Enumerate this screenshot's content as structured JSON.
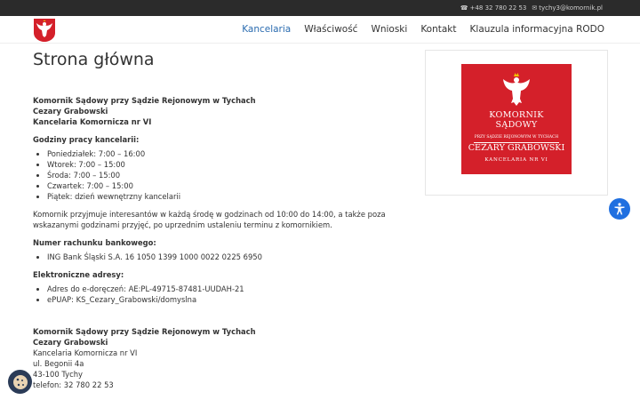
{
  "topbar": {
    "phone": "+48 32 780 22 53",
    "email": "tychy3@komornik.pl"
  },
  "nav": {
    "items": [
      {
        "label": "Kancelaria",
        "active": true
      },
      {
        "label": "Właściwość",
        "active": false
      },
      {
        "label": "Wnioski",
        "active": false
      },
      {
        "label": "Kontakt",
        "active": false
      },
      {
        "label": "Klauzula informacyjna RODO",
        "active": false
      }
    ]
  },
  "page": {
    "title": "Strona główna"
  },
  "content": {
    "header_line1": "Komornik Sądowy przy Sądzie Rejonowym w Tychach",
    "header_line2": "Cezary Grabowski",
    "header_line3": "Kancelaria Komornicza nr VI",
    "hours_title": "Godziny pracy kancelarii:",
    "hours": [
      "Poniedziałek: 7:00 – 16:00",
      "Wtorek: 7:00 – 15:00",
      "Środa: 7:00 – 15:00",
      "Czwartek: 7:00 – 15:00",
      "Piątek: dzień wewnętrzny kancelarii"
    ],
    "reception_text": "Komornik przyjmuje interesantów w każdą środę w godzinach od 10:00 do 14:00, a także poza wskazanymi godzinami przyjęć, po uprzednim ustaleniu terminu z komornikiem.",
    "bank_title": "Numer rachunku bankowego:",
    "bank_account": "ING Bank Śląski S.A. 16 1050 1399 1000 0022 0225 6950",
    "electronic_title": "Elektroniczne adresy:",
    "electronic": [
      "Adres do e-doręczeń: AE:PL-49715-87481-UUDAH-21",
      "ePUAP: KS_Cezary_Grabowski/domyslna"
    ],
    "footer_line1": "Komornik Sądowy przy Sądzie Rejonowym w Tychach",
    "footer_line2": "Cezary Grabowski",
    "footer_line3": "Kancelaria Komornicza nr VI",
    "footer_line4": "ul. Begonii 4a",
    "footer_line5": "43-100 Tychy",
    "footer_line6": "telefon: 32 780 22 53"
  },
  "emblem": {
    "title1": "KOMORNIK",
    "title2": "SĄDOWY",
    "sub": "PRZY SĄDZIE REJONOWYM W TYCHACH",
    "name": "CEZARY GRABOWSKI",
    "office": "KANCELARIA NR VI"
  },
  "colors": {
    "accent": "#2b6cb0",
    "emblem_red": "#d4202a",
    "topbar": "#2b2b2b"
  }
}
